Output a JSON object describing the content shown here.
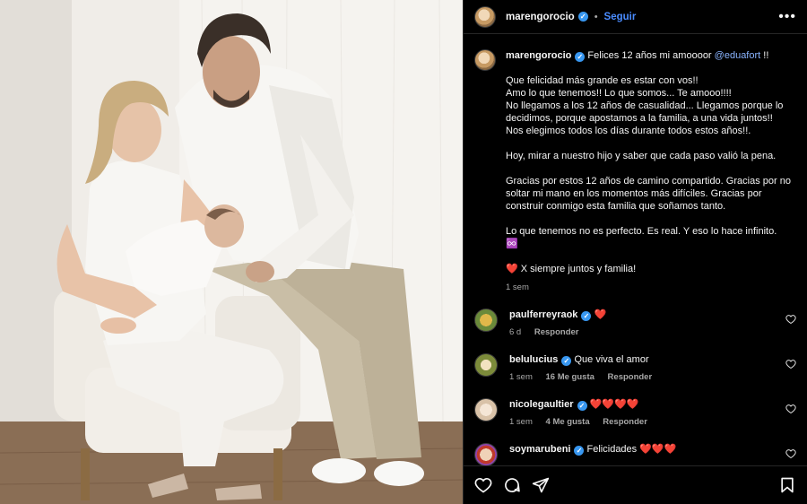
{
  "post": {
    "author": "marengorocio",
    "follow_label": "Seguir",
    "dot": "•",
    "more": "•••"
  },
  "caption": {
    "author": "marengorocio",
    "head_text": "Felices 12 años mi amoooor",
    "mention": "@eduafort",
    "head_tail": "!!",
    "body": "Que felicidad más grande es estar con vos!!\nAmo lo que tenemos!! Lo que somos... Te amooo!!!!\nNo llegamos a los 12 años de casualidad... Llegamos porque lo decidimos, porque apostamos a la familia, a una vida juntos!!\nNos elegimos todos los días durante todos estos años!!.\n\nHoy, mirar a nuestro hijo y saber que cada paso valió la pena.\n\nGracias por estos 12 años de camino compartido. Gracias por no soltar mi mano en los momentos más difíciles. Gracias por construir conmigo esta familia que soñamos tanto.\n\nLo que tenemos no es perfecto. Es real. Y eso lo hace infinito.\n♾️\n\n❤️ X siempre juntos y familia!",
    "time": "1 sem"
  },
  "comments": [
    {
      "user": "paulferreyraok",
      "text": "❤️",
      "time": "6 d",
      "likes": "",
      "reply": "Responder",
      "avatar_color": "#c9a13a"
    },
    {
      "user": "belulucius",
      "text": "Que viva el amor",
      "time": "1 sem",
      "likes": "16 Me gusta",
      "reply": "Responder",
      "avatar_color": "#7c8b3a"
    },
    {
      "user": "nicolegaultier",
      "text": "❤️❤️❤️❤️",
      "time": "1 sem",
      "likes": "4 Me gusta",
      "reply": "Responder",
      "avatar_color": "#d9c2a8"
    },
    {
      "user": "soymarubeni",
      "text": "Felicidades ❤️❤️❤️",
      "time": "",
      "likes": "",
      "reply": "",
      "avatar_color": "#c0392b"
    }
  ],
  "icons": {
    "like": "heart-icon",
    "comment": "comment-icon",
    "share": "share-icon",
    "save": "bookmark-icon"
  },
  "colors": {
    "background": "#000000",
    "link": "#4a8cff",
    "verified": "#3897f0",
    "muted": "#a8a8a8"
  }
}
